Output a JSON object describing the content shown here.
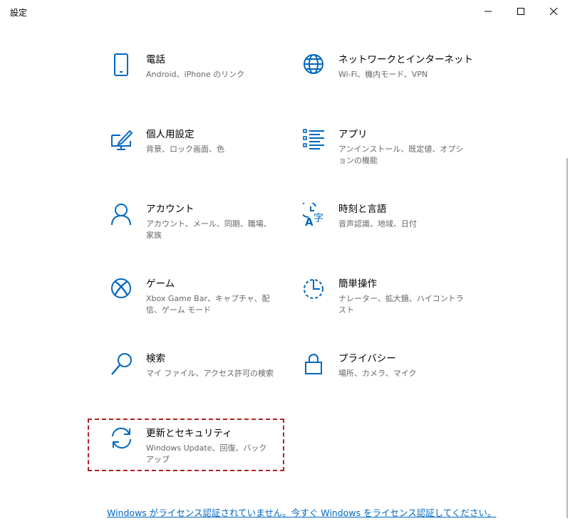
{
  "window": {
    "title": "設定"
  },
  "accent_color": "#0067c0",
  "focus_color": "#b22222",
  "tiles": [
    {
      "name": "電話",
      "desc": "Android、iPhone のリンク",
      "icon": "phone-icon"
    },
    {
      "name": "ネットワークとインターネット",
      "desc": "Wi-Fi、機内モード、VPN",
      "icon": "globe-icon"
    },
    {
      "name": "個人用設定",
      "desc": "背景、ロック画面、色",
      "icon": "personalization-icon"
    },
    {
      "name": "アプリ",
      "desc": "アンインストール、既定値、オプションの機能",
      "icon": "apps-list-icon"
    },
    {
      "name": "アカウント",
      "desc": "アカウント、メール、同期、職場、家族",
      "icon": "person-icon"
    },
    {
      "name": "時刻と言語",
      "desc": "音声認識、地域、日付",
      "icon": "time-language-icon"
    },
    {
      "name": "ゲーム",
      "desc": "Xbox Game Bar、キャプチャ、配信、ゲーム モード",
      "icon": "xbox-icon"
    },
    {
      "name": "簡単操作",
      "desc": "ナレーター、拡大鏡、ハイコントラスト",
      "icon": "ease-of-access-icon"
    },
    {
      "name": "検索",
      "desc": "マイ ファイル、アクセス許可の検索",
      "icon": "search-icon"
    },
    {
      "name": "プライバシー",
      "desc": "場所、カメラ、マイク",
      "icon": "lock-icon"
    },
    {
      "name": "更新とセキュリティ",
      "desc": "Windows Update、回復、バックアップ",
      "icon": "sync-icon"
    }
  ],
  "activation_link": "Windows がライセンス認証されていません。今すぐ Windows をライセンス認証してください。"
}
